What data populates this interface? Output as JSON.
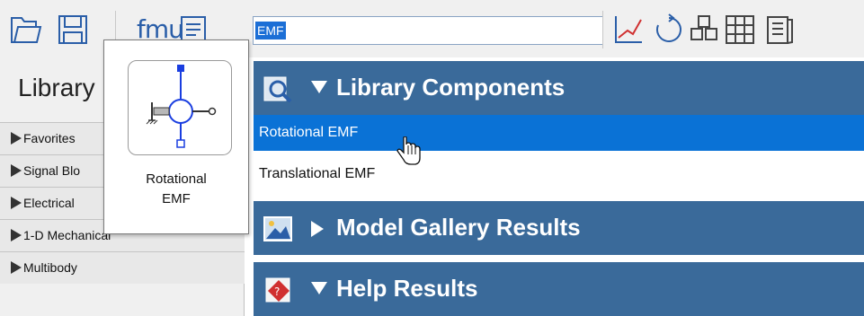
{
  "toolbar": {
    "fmi_label": "fmu",
    "search": {
      "value": "EMF"
    }
  },
  "library": {
    "title": "Library",
    "items": [
      {
        "label": "Favorites"
      },
      {
        "label": "Signal Blo"
      },
      {
        "label": "Electrical"
      },
      {
        "label": "1-D Mechanical"
      },
      {
        "label": "Multibody"
      }
    ]
  },
  "results": {
    "sections": [
      {
        "title": "Library Components",
        "expanded": true,
        "icon": "magnifier-icon"
      },
      {
        "title": "Model Gallery Results",
        "expanded": false,
        "icon": "gallery-icon"
      },
      {
        "title": "Help Results",
        "expanded": true,
        "icon": "help-book-icon"
      }
    ],
    "items": [
      {
        "label": "Rotational EMF",
        "selected": true
      },
      {
        "label": "Translational EMF",
        "selected": false
      }
    ]
  },
  "card": {
    "line1": "Rotational",
    "line2": "EMF"
  },
  "colors": {
    "header_blue": "#3a6a9a",
    "selection_blue": "#0a72d6",
    "icon_blue": "#2a5ea8"
  }
}
